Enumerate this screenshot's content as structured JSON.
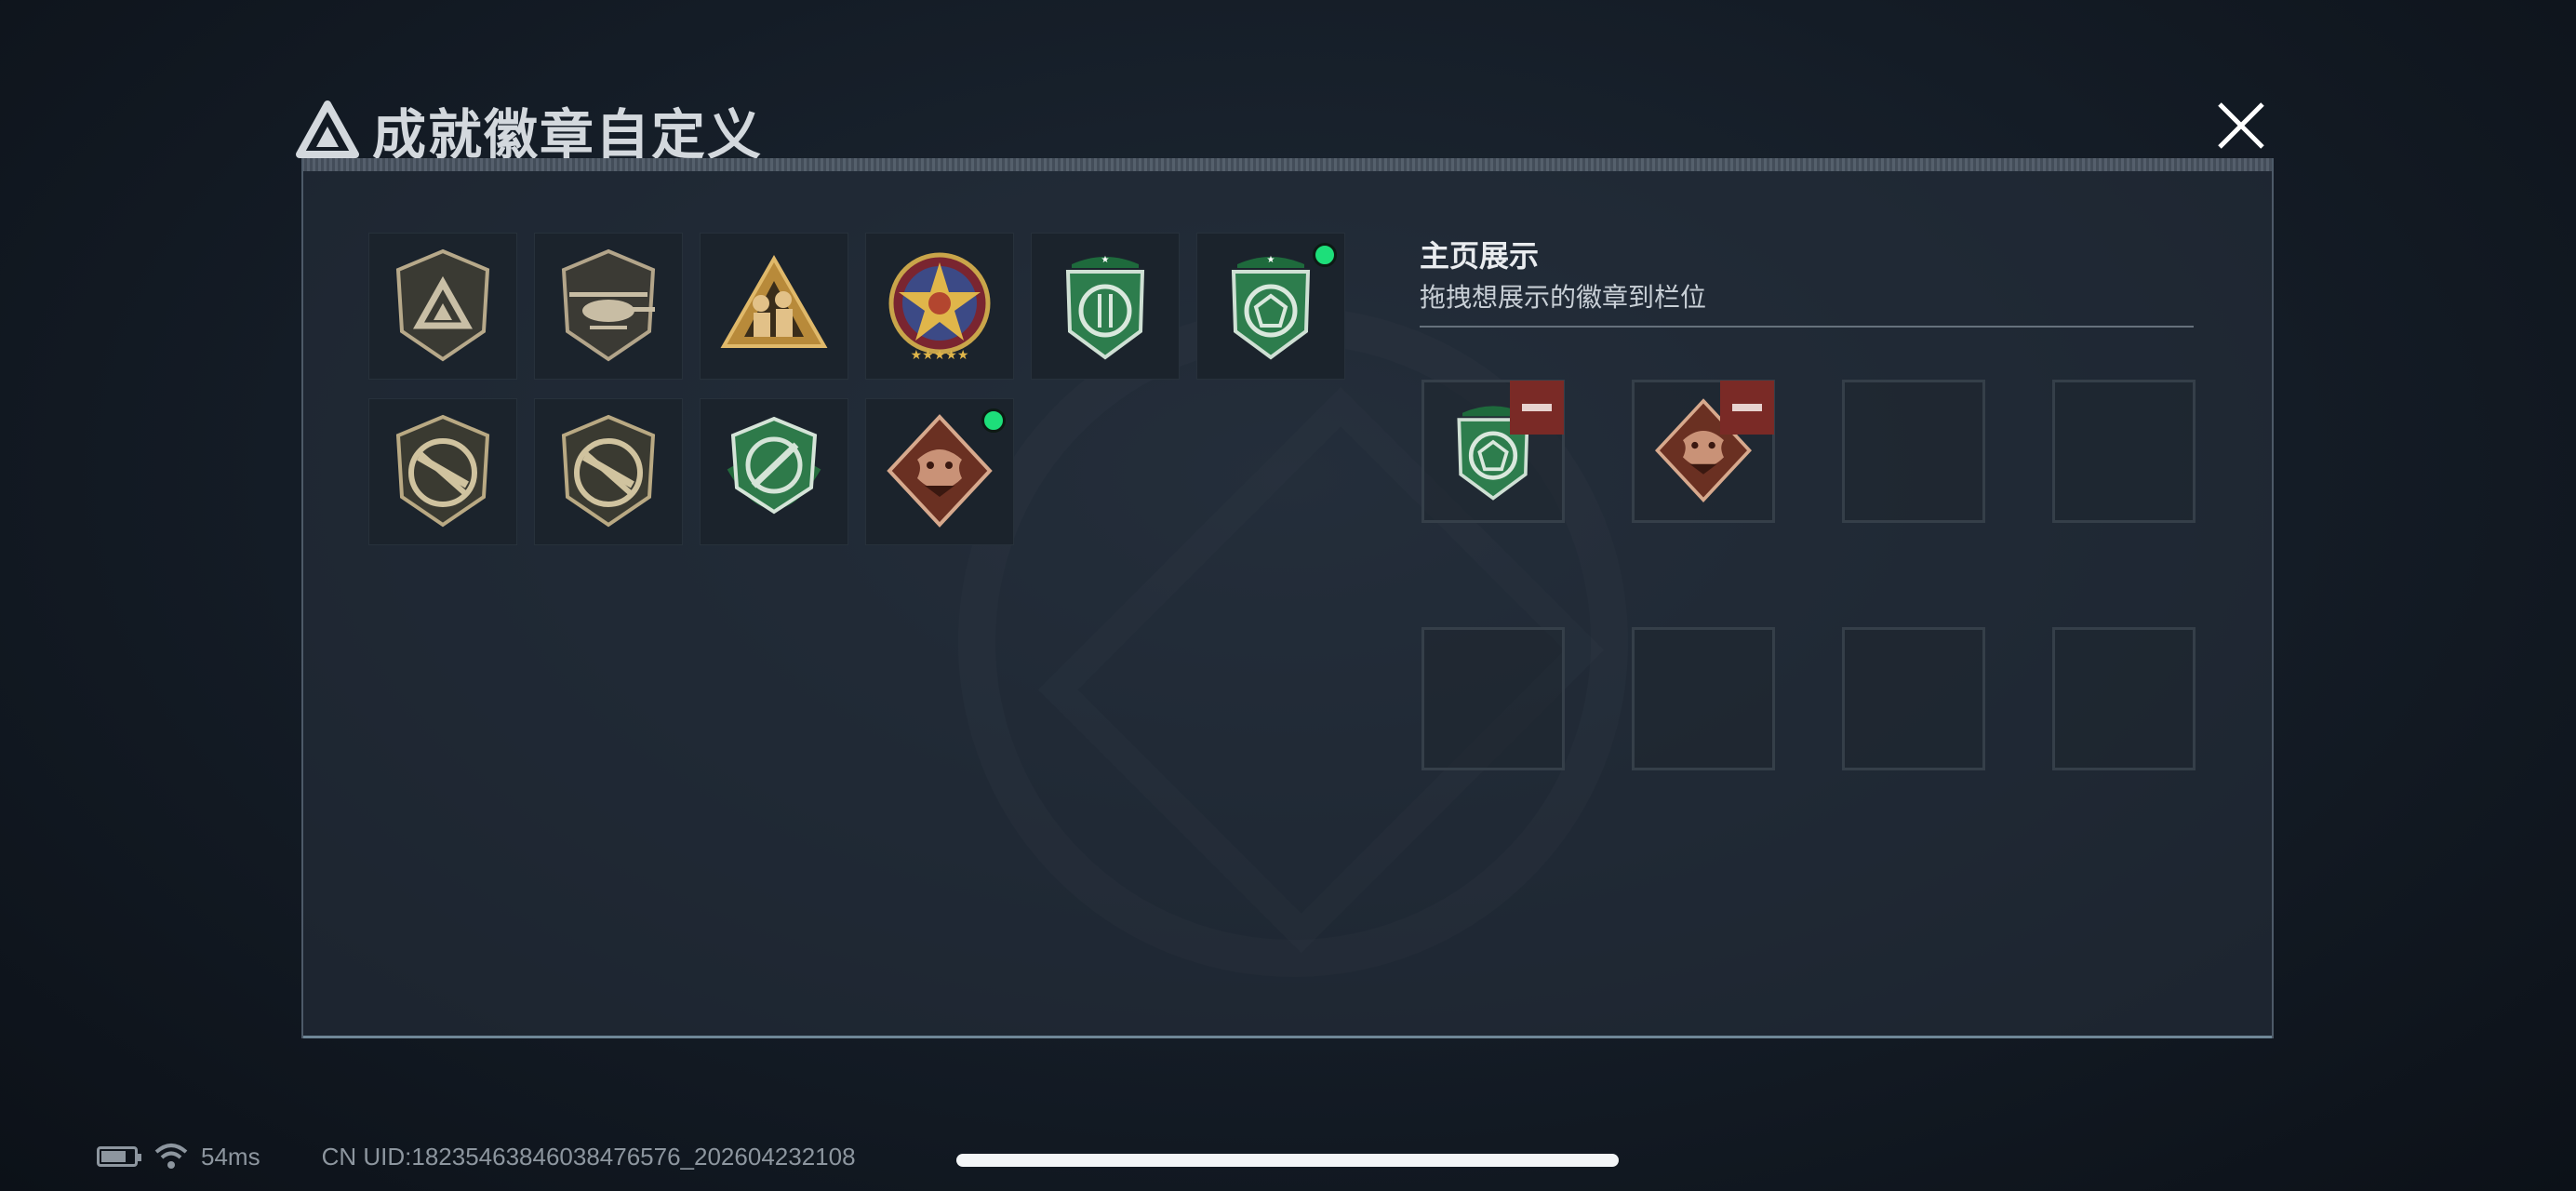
{
  "header": {
    "title": "成就徽章自定义",
    "tiny_text": "..:.: :::: ::::"
  },
  "inventory": {
    "badges": [
      {
        "name": "triangle-shield-badge",
        "equipped": false
      },
      {
        "name": "helicopter-badge",
        "equipped": false
      },
      {
        "name": "soldiers-triangle-badge",
        "equipped": false
      },
      {
        "name": "star-medal-badge",
        "equipped": false
      },
      {
        "name": "green-emblem-badge",
        "equipped": false
      },
      {
        "name": "green-gem-badge",
        "equipped": true
      },
      {
        "name": "rifle-shield-badge",
        "equipped": false
      },
      {
        "name": "rifle-shield-badge-2",
        "equipped": false
      },
      {
        "name": "green-knife-badge",
        "equipped": false
      },
      {
        "name": "dragon-badge",
        "equipped": true
      }
    ]
  },
  "showcase": {
    "title": "主页展示",
    "subtitle": "拖拽想展示的徽章到栏位",
    "slots": [
      {
        "badge": "green-gem-badge"
      },
      {
        "badge": "dragon-badge"
      },
      {
        "badge": null
      },
      {
        "badge": null
      },
      {
        "badge": null
      },
      {
        "badge": null
      },
      {
        "badge": null
      },
      {
        "badge": null
      }
    ]
  },
  "status": {
    "ping": "54ms",
    "uid": "CN UID:18235463846038476576_202604232108",
    "battery_level": 0.75
  },
  "colors": {
    "equipped_dot": "#1ddf7a",
    "remove_button": "#7a2a26",
    "panel_border": "#4d5a68"
  }
}
